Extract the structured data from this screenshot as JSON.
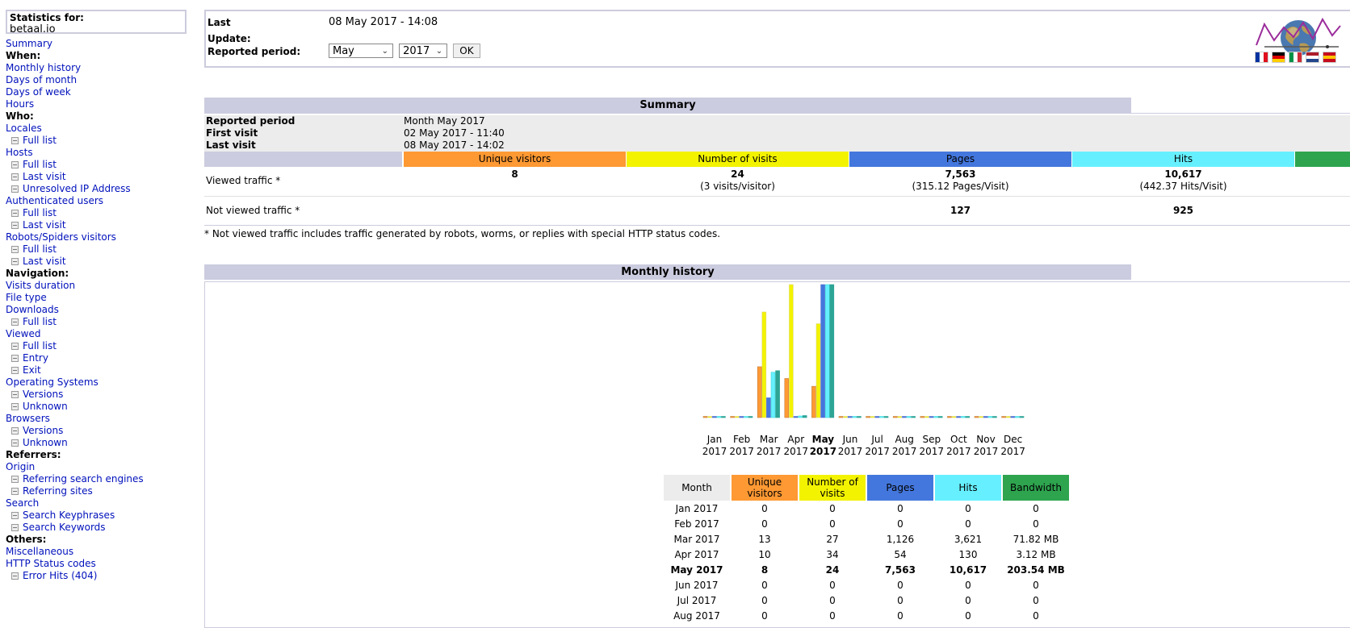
{
  "menu": {
    "stats_label": "Statistics for:",
    "site": "betaal.io",
    "items": [
      {
        "label": "Summary",
        "type": "link"
      },
      {
        "label": "When:",
        "type": "head"
      },
      {
        "label": "Monthly history",
        "type": "link"
      },
      {
        "label": "Days of month",
        "type": "link"
      },
      {
        "label": "Days of week",
        "type": "link"
      },
      {
        "label": "Hours",
        "type": "link"
      },
      {
        "label": "Who:",
        "type": "head"
      },
      {
        "label": "Locales",
        "type": "link"
      },
      {
        "label": "Full list",
        "type": "sub"
      },
      {
        "label": "Hosts",
        "type": "link"
      },
      {
        "label": "Full list",
        "type": "sub"
      },
      {
        "label": "Last visit",
        "type": "sub"
      },
      {
        "label": "Unresolved IP Address",
        "type": "sub"
      },
      {
        "label": "Authenticated users",
        "type": "link"
      },
      {
        "label": "Full list",
        "type": "sub"
      },
      {
        "label": "Last visit",
        "type": "sub"
      },
      {
        "label": "Robots/Spiders visitors",
        "type": "link"
      },
      {
        "label": "Full list",
        "type": "sub"
      },
      {
        "label": "Last visit",
        "type": "sub"
      },
      {
        "label": "Navigation:",
        "type": "head"
      },
      {
        "label": "Visits duration",
        "type": "link"
      },
      {
        "label": "File type",
        "type": "link"
      },
      {
        "label": "Downloads",
        "type": "link"
      },
      {
        "label": "Full list",
        "type": "sub"
      },
      {
        "label": "Viewed",
        "type": "link"
      },
      {
        "label": "Full list",
        "type": "sub"
      },
      {
        "label": "Entry",
        "type": "sub"
      },
      {
        "label": "Exit",
        "type": "sub"
      },
      {
        "label": "Operating Systems",
        "type": "link"
      },
      {
        "label": "Versions",
        "type": "sub"
      },
      {
        "label": "Unknown",
        "type": "sub"
      },
      {
        "label": "Browsers",
        "type": "link"
      },
      {
        "label": "Versions",
        "type": "sub"
      },
      {
        "label": "Unknown",
        "type": "sub"
      },
      {
        "label": "Referrers:",
        "type": "head"
      },
      {
        "label": "Origin",
        "type": "link"
      },
      {
        "label": "Referring search engines",
        "type": "sub"
      },
      {
        "label": "Referring sites",
        "type": "sub"
      },
      {
        "label": "Search",
        "type": "link"
      },
      {
        "label": "Search Keyphrases",
        "type": "sub"
      },
      {
        "label": "Search Keywords",
        "type": "sub"
      },
      {
        "label": "Others:",
        "type": "head"
      },
      {
        "label": "Miscellaneous",
        "type": "link"
      },
      {
        "label": "HTTP Status codes",
        "type": "link"
      },
      {
        "label": "Error Hits (404)",
        "type": "sub"
      }
    ]
  },
  "top": {
    "last_update_label": "Last Update:",
    "last_update_value": "08 May 2017 - 14:08",
    "period_label": "Reported period:",
    "month_select": "May",
    "year_select": "2017",
    "ok_label": "OK",
    "flags": [
      "french-flag-icon",
      "german-flag-icon",
      "italian-flag-icon",
      "dutch-flag-icon",
      "spanish-flag-icon"
    ]
  },
  "summary": {
    "title": "Summary",
    "rows": [
      {
        "k": "Reported period",
        "v": "Month May 2017"
      },
      {
        "k": "First visit",
        "v": "02 May 2017 - 11:40"
      },
      {
        "k": "Last visit",
        "v": "08 May 2017 - 14:02"
      }
    ],
    "cols": [
      "Unique visitors",
      "Number of visits",
      "Pages",
      "Hits"
    ],
    "viewed_label": "Viewed traffic *",
    "viewed": {
      "unique": "8",
      "visits": "24",
      "visits_sub": "(3 visits/visitor)",
      "pages": "7,563",
      "pages_sub": "(315.12 Pages/Visit)",
      "hits": "10,617",
      "hits_sub": "(442.37 Hits/Visit)"
    },
    "not_viewed_label": "Not viewed traffic *",
    "not_viewed": {
      "pages": "127",
      "hits": "925"
    },
    "note": "* Not viewed traffic includes traffic generated by robots, worms, or replies with special HTTP status codes."
  },
  "colors": {
    "unique": "#ff9933",
    "visits": "#f3f300",
    "pages": "#4477dd",
    "hits": "#66f0ff",
    "bandwidth": "#2ea495",
    "header_bg": "#cccce0"
  },
  "history": {
    "title": "Monthly history",
    "headers": [
      "Month",
      "Unique visitors",
      "Number of visits",
      "Pages",
      "Hits",
      "Bandwidth"
    ],
    "rows": [
      [
        "Jan 2017",
        "0",
        "0",
        "0",
        "0",
        "0"
      ],
      [
        "Feb 2017",
        "0",
        "0",
        "0",
        "0",
        "0"
      ],
      [
        "Mar 2017",
        "13",
        "27",
        "1,126",
        "3,621",
        "71.82 MB"
      ],
      [
        "Apr 2017",
        "10",
        "34",
        "54",
        "130",
        "3.12 MB"
      ],
      [
        "May 2017",
        "8",
        "24",
        "7,563",
        "10,617",
        "203.54 MB"
      ],
      [
        "Jun 2017",
        "0",
        "0",
        "0",
        "0",
        "0"
      ],
      [
        "Jul 2017",
        "0",
        "0",
        "0",
        "0",
        "0"
      ],
      [
        "Aug 2017",
        "0",
        "0",
        "0",
        "0",
        "0"
      ]
    ],
    "current_month": "May 2017"
  },
  "chart_data": {
    "type": "bar",
    "categories": [
      "Jan 2017",
      "Feb 2017",
      "Mar 2017",
      "Apr 2017",
      "May 2017",
      "Jun 2017",
      "Jul 2017",
      "Aug 2017",
      "Sep 2017",
      "Oct 2017",
      "Nov 2017",
      "Dec 2017"
    ],
    "month_labels": [
      "Jan",
      "Feb",
      "Mar",
      "Apr",
      "May",
      "Jun",
      "Jul",
      "Aug",
      "Sep",
      "Oct",
      "Nov",
      "Dec"
    ],
    "year_label": "2017",
    "current_index": 4,
    "series": [
      {
        "name": "Unique visitors",
        "values": [
          0,
          0,
          13,
          10,
          8,
          0,
          0,
          0,
          0,
          0,
          0,
          0
        ]
      },
      {
        "name": "Number of visits",
        "values": [
          0,
          0,
          27,
          34,
          24,
          0,
          0,
          0,
          0,
          0,
          0,
          0
        ]
      },
      {
        "name": "Pages",
        "values": [
          0,
          0,
          1126,
          54,
          7563,
          0,
          0,
          0,
          0,
          0,
          0,
          0
        ]
      },
      {
        "name": "Hits",
        "values": [
          0,
          0,
          3621,
          130,
          10617,
          0,
          0,
          0,
          0,
          0,
          0,
          0
        ]
      },
      {
        "name": "Bandwidth",
        "values": [
          0,
          0,
          71.82,
          3.12,
          203.54,
          0,
          0,
          0,
          0,
          0,
          0,
          0
        ]
      }
    ]
  }
}
